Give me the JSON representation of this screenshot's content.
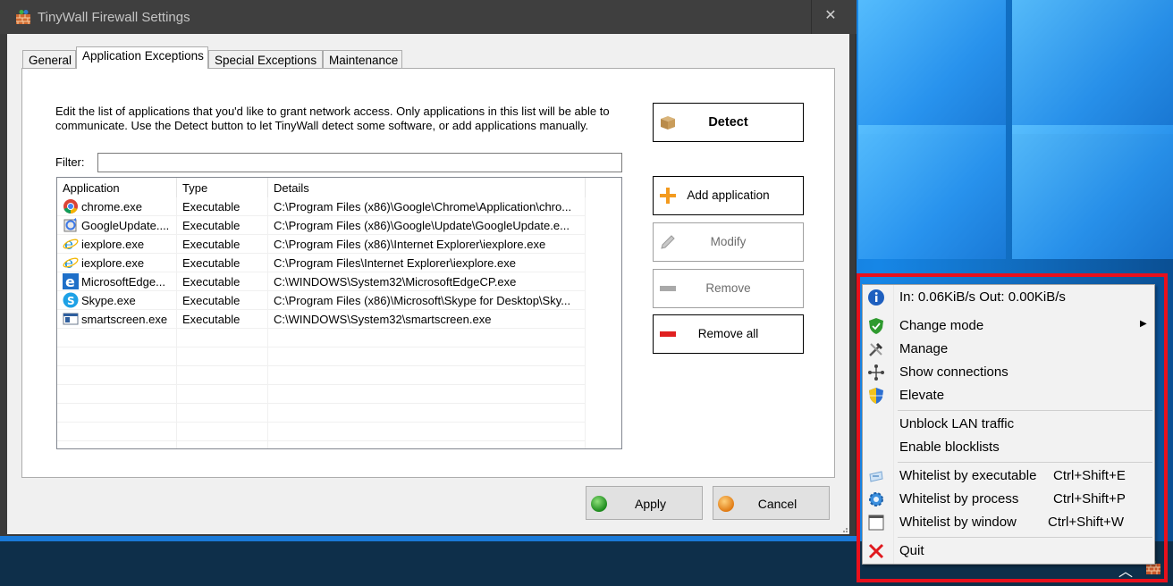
{
  "window": {
    "title": "TinyWall Firewall Settings",
    "close_glyph": "✕"
  },
  "tabs": [
    {
      "label": "General",
      "active": false
    },
    {
      "label": "Application Exceptions",
      "active": true
    },
    {
      "label": "Special Exceptions",
      "active": false
    },
    {
      "label": "Maintenance",
      "active": false
    }
  ],
  "panel": {
    "description": "Edit the list of applications that you'd like to grant network access. Only applications in this list will be able to communicate. Use the Detect button to let TinyWall detect some software, or add applications manually.",
    "filter_label": "Filter:",
    "filter_value": ""
  },
  "list": {
    "columns": [
      "Application",
      "Type",
      "Details"
    ],
    "rows": [
      {
        "app": "chrome.exe",
        "type": "Executable",
        "details": "C:\\Program Files (x86)\\Google\\Chrome\\Application\\chro...",
        "icon": "chrome-icon"
      },
      {
        "app": "GoogleUpdate....",
        "type": "Executable",
        "details": "C:\\Program Files (x86)\\Google\\Update\\GoogleUpdate.e...",
        "icon": "google-update-icon"
      },
      {
        "app": "iexplore.exe",
        "type": "Executable",
        "details": "C:\\Program Files (x86)\\Internet Explorer\\iexplore.exe",
        "icon": "internet-explorer-icon"
      },
      {
        "app": "iexplore.exe",
        "type": "Executable",
        "details": "C:\\Program Files\\Internet Explorer\\iexplore.exe",
        "icon": "internet-explorer-icon"
      },
      {
        "app": "MicrosoftEdge...",
        "type": "Executable",
        "details": "C:\\WINDOWS\\System32\\MicrosoftEdgeCP.exe",
        "icon": "edge-icon"
      },
      {
        "app": "Skype.exe",
        "type": "Executable",
        "details": "C:\\Program Files (x86)\\Microsoft\\Skype for Desktop\\Sky...",
        "icon": "skype-icon"
      },
      {
        "app": "smartscreen.exe",
        "type": "Executable",
        "details": "C:\\WINDOWS\\System32\\smartscreen.exe",
        "icon": "smartscreen-icon"
      }
    ]
  },
  "buttons": {
    "detect": "Detect",
    "add": "Add application",
    "modify": "Modify",
    "remove": "Remove",
    "remove_all": "Remove all",
    "apply": "Apply",
    "cancel": "Cancel"
  },
  "menu": {
    "traffic": "In: 0.06KiB/s   Out: 0.00KiB/s",
    "items": {
      "change_mode": "Change mode",
      "manage": "Manage",
      "show_connections": "Show connections",
      "elevate": "Elevate",
      "unblock_lan": "Unblock LAN traffic",
      "enable_blocklists": "Enable blocklists",
      "wl_exe": "Whitelist by executable",
      "wl_exe_short": "Ctrl+Shift+E",
      "wl_proc": "Whitelist by process",
      "wl_proc_short": "Ctrl+Shift+P",
      "wl_win": "Whitelist by window",
      "wl_win_short": "Ctrl+Shift+W",
      "quit": "Quit"
    },
    "submenu_arrow": "▶"
  },
  "taskbar": {
    "chevron": "︿"
  },
  "colors": {
    "highlight": "#e8101c",
    "apply_dot": "#1c8a1c",
    "cancel_dot": "#e07b14"
  }
}
